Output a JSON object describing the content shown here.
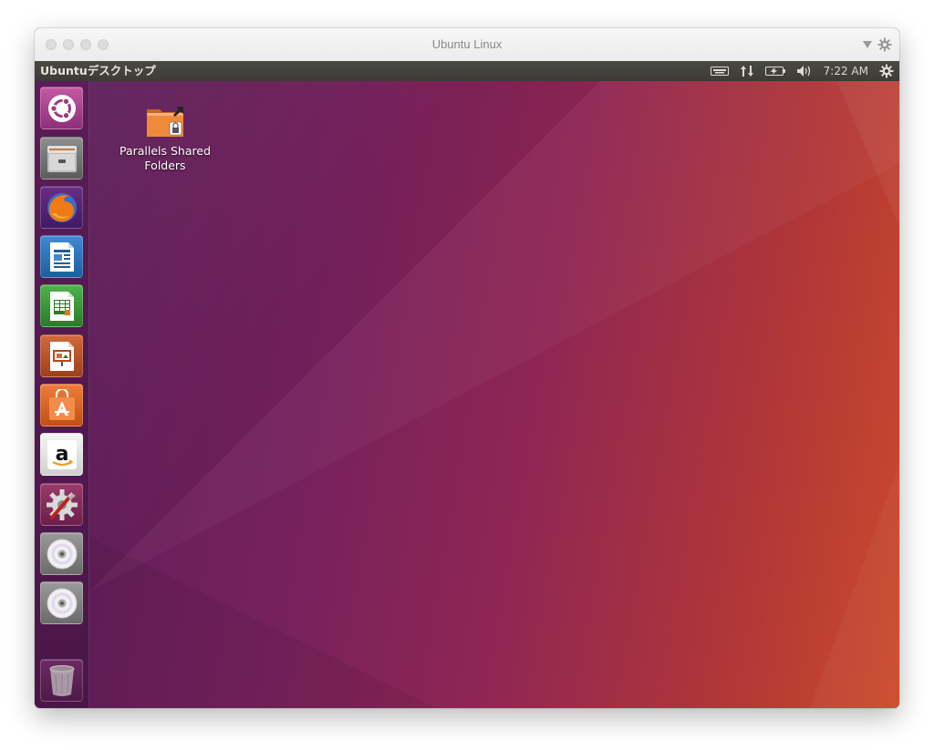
{
  "window": {
    "title": "Ubuntu Linux"
  },
  "panel": {
    "app_title": "Ubuntuデスクトップ",
    "clock": "7:22 AM",
    "indicators": [
      "keyboard-icon",
      "network-icon",
      "battery-icon",
      "volume-icon",
      "session-gear-icon"
    ]
  },
  "launcher": {
    "items": [
      {
        "name": "ubuntu-dash-icon"
      },
      {
        "name": "files-icon"
      },
      {
        "name": "firefox-icon"
      },
      {
        "name": "libreoffice-writer-icon"
      },
      {
        "name": "libreoffice-calc-icon"
      },
      {
        "name": "libreoffice-impress-icon"
      },
      {
        "name": "ubuntu-software-icon"
      },
      {
        "name": "amazon-icon"
      },
      {
        "name": "system-settings-icon"
      },
      {
        "name": "dvd-drive-icon"
      },
      {
        "name": "dvd-drive-icon"
      },
      {
        "name": "trash-icon"
      }
    ]
  },
  "desktop": {
    "icons": [
      {
        "label_line1": "Parallels Shared",
        "label_line2": "Folders",
        "icon": "shared-folder-icon"
      }
    ]
  },
  "colors": {
    "panel": "#3c3b37",
    "launcher": "#4a1647",
    "wallpaper_left": "#5e1d5b",
    "wallpaper_right": "#cc4a2a",
    "ubuntu_orange": "#e95420"
  }
}
